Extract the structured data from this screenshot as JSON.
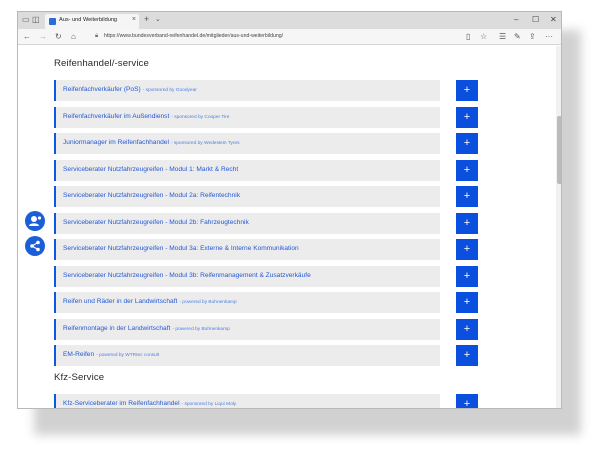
{
  "browser": {
    "tab_title": "Aus- und Weiterbildung",
    "url": "https://www.bundesverband-reifenhandel.de/mitglieder/aus-und-weiterbildung/",
    "icons": [
      "back-arrow-icon",
      "forward-arrow-icon",
      "refresh-icon",
      "home-icon",
      "lock-icon",
      "reading-view-icon",
      "favorite-star-icon",
      "favorites-hub-icon",
      "pen-icon",
      "share-icon",
      "more-icon"
    ],
    "controls": {
      "new_tab": "+",
      "tab_close": "×",
      "minimize": "–",
      "maximize": "☐",
      "close": "✕",
      "more": "···"
    }
  },
  "sections": [
    {
      "title": "Reifenhandel/-service",
      "items": [
        {
          "label": "Reifenfachverkäufer (PoS)",
          "sponsor": "- sponsored by Goodyear"
        },
        {
          "label": "Reifenfachverkäufer im Außendienst",
          "sponsor": "- sponsored by Cooper Tire"
        },
        {
          "label": "Juniormanager im Reifenfachhandel",
          "sponsor": "- sponsored by Wedestein Tyres"
        },
        {
          "label": "Serviceberater Nutzfahrzeugreifen - Modul 1: Markt & Recht",
          "sponsor": ""
        },
        {
          "label": "Serviceberater Nutzfahrzeugreifen - Modul 2a: Reifentechnik",
          "sponsor": ""
        },
        {
          "label": "Serviceberater Nutzfahrzeugreifen - Modul 2b: Fahrzeugtechnik",
          "sponsor": ""
        },
        {
          "label": "Serviceberater Nutzfahrzeugreifen - Modul 3a: Externe & Interne Kommunikation",
          "sponsor": ""
        },
        {
          "label": "Serviceberater Nutzfahrzeugreifen - Modul 3b: Reifenmanagement & Zusatzverkäufe",
          "sponsor": ""
        },
        {
          "label": "Reifen und Räder in der Landwirtschaft",
          "sponsor": "- powered by Bohnenkamp"
        },
        {
          "label": "Reifenmontage in der Landwirtschaft",
          "sponsor": "- powered by Bohnenkamp"
        },
        {
          "label": "EM-Reifen",
          "sponsor": "- powered by WTRtec consult"
        }
      ]
    },
    {
      "title": "Kfz-Service",
      "items": [
        {
          "label": "Kfz-Serviceberater im Reifenfachhandel",
          "sponsor": "- sponsored by Liqui Moly"
        }
      ]
    }
  ],
  "expand_label": "+",
  "colors": {
    "accent": "#0b4fde",
    "link": "#2459d6",
    "item_bg": "#ececec"
  }
}
